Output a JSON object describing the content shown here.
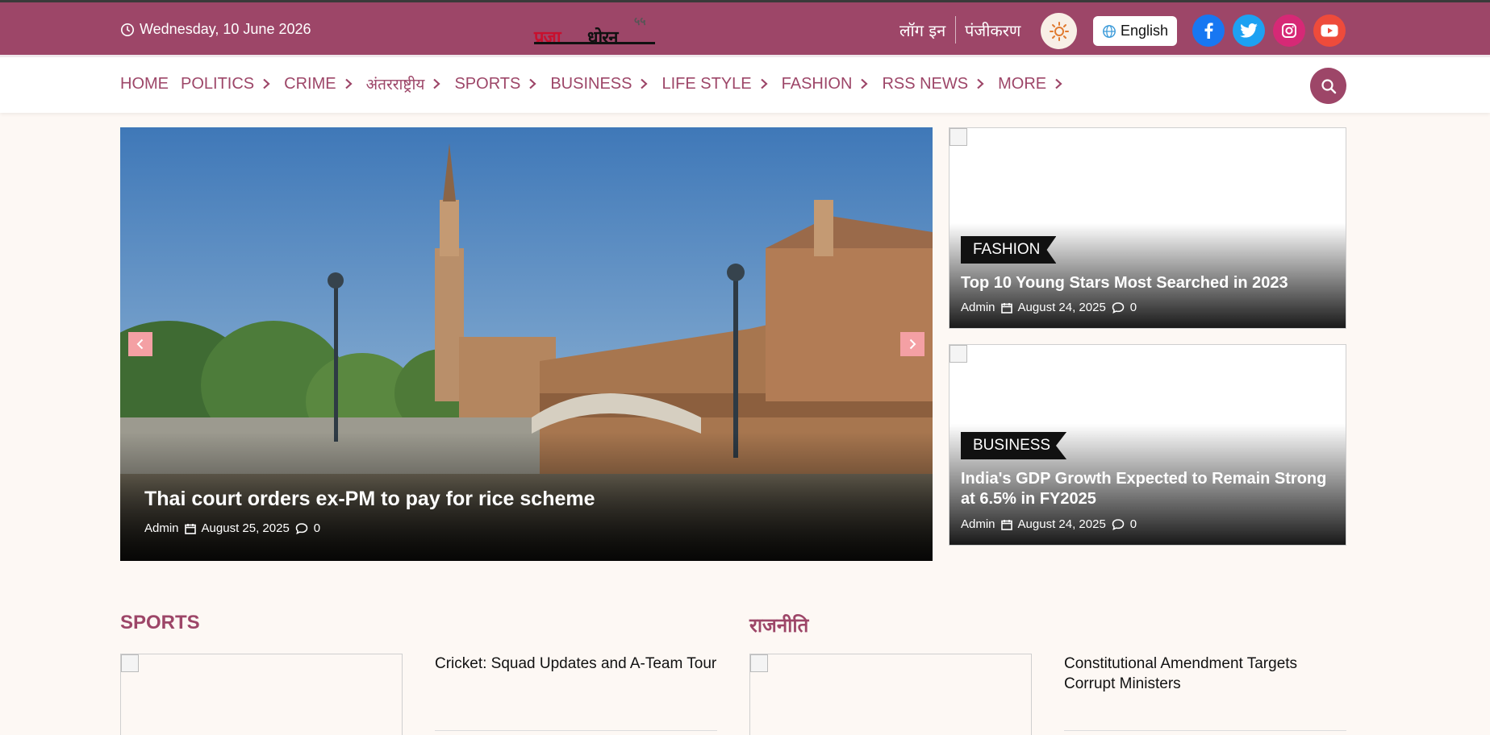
{
  "topbar": {
    "date": "Wednesday, 10 June 2026",
    "logo_word_red": "प्रजा",
    "logo_word_black": "धोरन",
    "logo_number": "५५",
    "login": "लॉग इन",
    "register": "पंजीकरण",
    "language": "English",
    "bg_color": "#9d4668"
  },
  "nav": {
    "items": [
      {
        "label": "HOME"
      },
      {
        "label": "POLITICS"
      },
      {
        "label": "CRIME"
      },
      {
        "label": "अंतरराष्ट्रीय"
      },
      {
        "label": "SPORTS"
      },
      {
        "label": "BUSINESS"
      },
      {
        "label": "LIFE STYLE"
      },
      {
        "label": "FASHION"
      },
      {
        "label": "RSS NEWS"
      },
      {
        "label": "MORE"
      }
    ]
  },
  "hero": {
    "title": "Thai court orders ex-PM to pay for rice scheme",
    "author": "Admin",
    "date": "August 25, 2025",
    "comments": "0"
  },
  "side_cards": [
    {
      "category": "FASHION",
      "title": "Top 10 Young Stars Most Searched in 2023",
      "author": "Admin",
      "date": "August 24, 2025",
      "comments": "0"
    },
    {
      "category": "BUSINESS",
      "title": "India's GDP Growth Expected to Remain Strong at 6.5% in FY2025",
      "author": "Admin",
      "date": "August 24, 2025",
      "comments": "0"
    }
  ],
  "sections": [
    {
      "title": "SPORTS",
      "headline": "Cricket: Squad Updates and A-Team Tour"
    },
    {
      "title": "राजनीति",
      "headline": "Constitutional Amendment Targets Corrupt Ministers"
    }
  ],
  "icons": {
    "clock": "clock-icon",
    "theme": "sun-icon",
    "language": "globe-icon",
    "facebook": "facebook-icon",
    "twitter": "twitter-icon",
    "instagram": "instagram-icon",
    "youtube": "youtube-icon",
    "search": "search-icon"
  }
}
